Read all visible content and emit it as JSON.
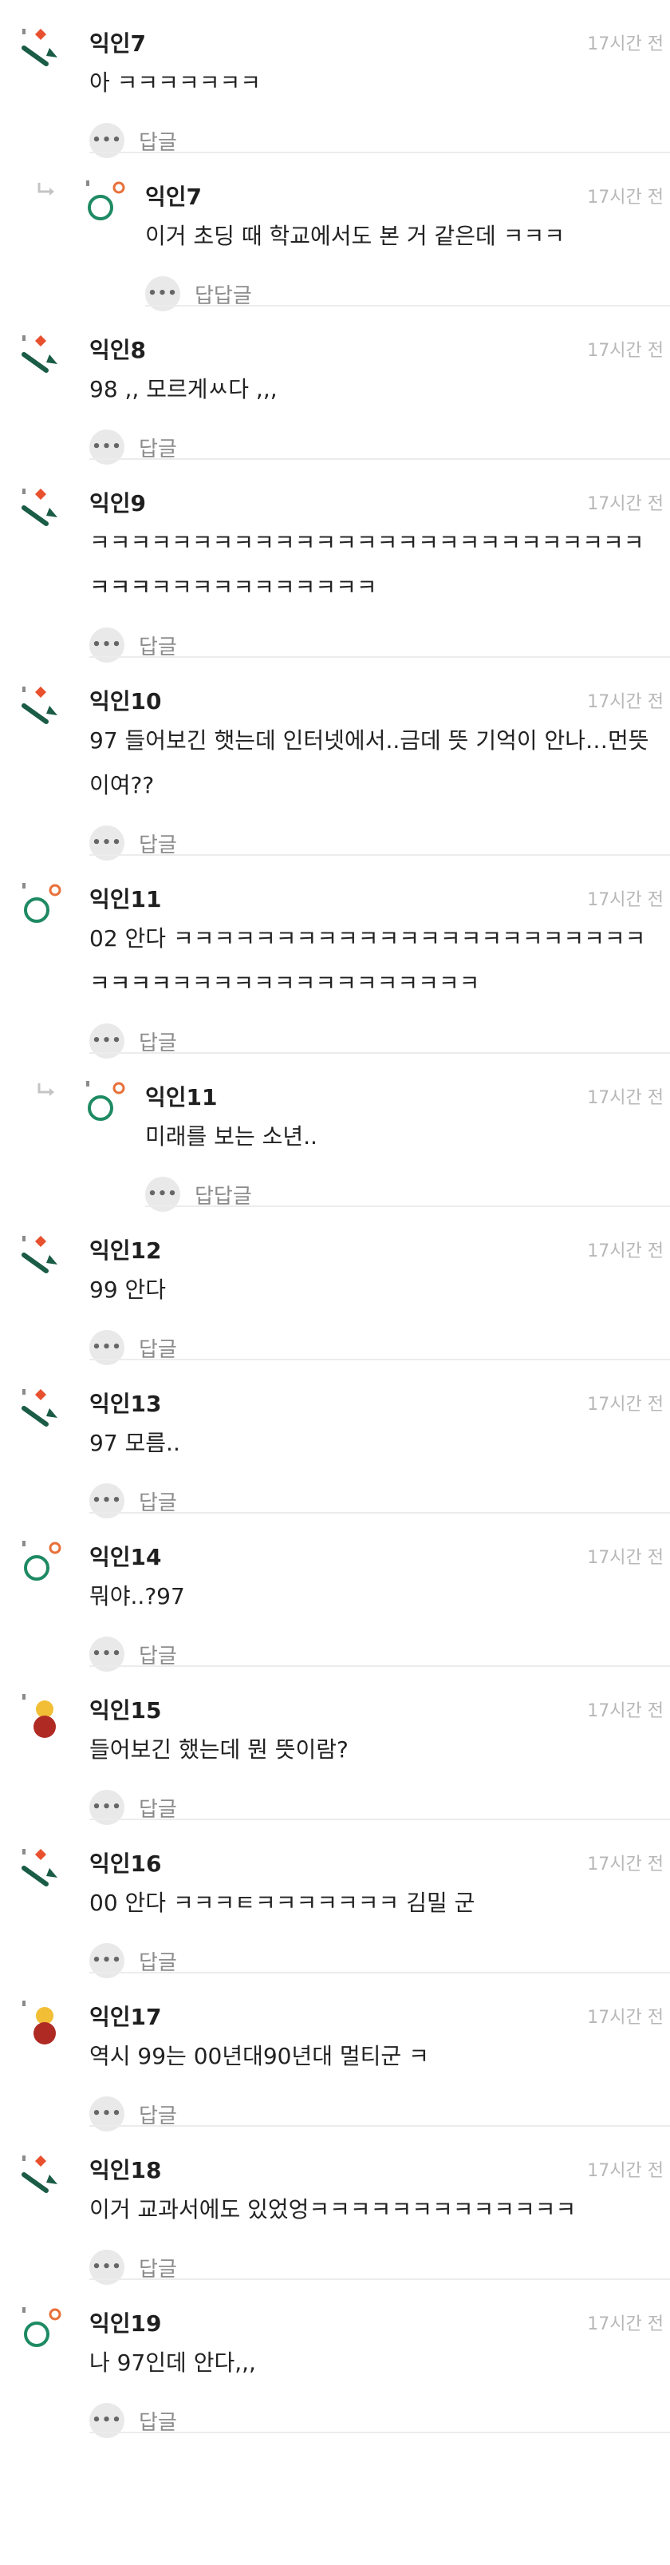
{
  "comments": [
    {
      "kind": "top",
      "avatar": "green-flag",
      "name": "익인7",
      "time": "17시간 전",
      "lines": [
        "아 ㅋㅋㅋㅋㅋㅋㅋ"
      ],
      "reply": "답글"
    },
    {
      "kind": "sub",
      "avatar": "ring",
      "name": "익인7",
      "time": "17시간 전",
      "lines": [
        "이거 초딩 때 학교에서도 본 거 같은데 ㅋㅋㅋ"
      ],
      "reply": "답답글"
    },
    {
      "kind": "top",
      "avatar": "green-flag",
      "name": "익인8",
      "time": "17시간 전",
      "lines": [
        "98 ,, 모르게ㅆ다 ,,,"
      ],
      "reply": "답글"
    },
    {
      "kind": "top",
      "avatar": "green-flag",
      "name": "익인9",
      "time": "17시간 전",
      "lines": [
        "ㅋㅋㅋㅋㅋㅋㅋㅋㅋㅋㅋㅋㅋㅋㅋㅋㅋㅋㅋㅋㅋㅋㅋㅋㅋㅋㅋㅋㅋㅋ",
        "ㅋㅋㅋㅋㅋㅋㅋㅋㅋㅋㅋㅋㅋㅋ"
      ],
      "reply": "답글"
    },
    {
      "kind": "top",
      "avatar": "green-flag",
      "name": "익인10",
      "time": "17시간 전",
      "lines": [
        "97 들어보긴 햇는데 인터넷에서..금데 뜻 기억이 안나…먼뜻",
        "이여??"
      ],
      "reply": "답글"
    },
    {
      "kind": "top",
      "avatar": "ring",
      "name": "익인11",
      "time": "17시간 전",
      "lines": [
        "02 안다 ㅋㅋㅋㅋㅋㅋㅋㅋㅋㅋㅋㅋㅋㅋㅋㅋㅋㅋㅋㅋㅋㅋㅋㅋㅋㅋㅋ",
        "ㅋㅋㅋㅋㅋㅋㅋㅋㅋㅋㅋㅋㅋㅋㅋㅋㅋㅋㅋ"
      ],
      "reply": "답글"
    },
    {
      "kind": "sub",
      "avatar": "ring",
      "name": "익인11",
      "time": "17시간 전",
      "lines": [
        "미래를 보는 소년.."
      ],
      "reply": "답답글"
    },
    {
      "kind": "top",
      "avatar": "green-flag",
      "name": "익인12",
      "time": "17시간 전",
      "lines": [
        "99 안다"
      ],
      "reply": "답글"
    },
    {
      "kind": "top",
      "avatar": "green-flag",
      "name": "익인13",
      "time": "17시간 전",
      "lines": [
        "97 모름.."
      ],
      "reply": "답글"
    },
    {
      "kind": "top",
      "avatar": "ring",
      "name": "익인14",
      "time": "17시간 전",
      "lines": [
        "뭐야..?97"
      ],
      "reply": "답글"
    },
    {
      "kind": "top",
      "avatar": "snowman",
      "name": "익인15",
      "time": "17시간 전",
      "lines": [
        "들어보긴 했는데 뭔 뜻이람?"
      ],
      "reply": "답글"
    },
    {
      "kind": "top",
      "avatar": "green-flag",
      "name": "익인16",
      "time": "17시간 전",
      "lines": [
        "00 안다 ㅋㅋㅋㅌㅋㅋㅋㅋㅋㅋㅋ 김밀 군"
      ],
      "reply": "답글"
    },
    {
      "kind": "top",
      "avatar": "snowman",
      "name": "익인17",
      "time": "17시간 전",
      "lines": [
        "역시 99는 00년대90년대 멀티군 ㅋ"
      ],
      "reply": "답글"
    },
    {
      "kind": "top",
      "avatar": "green-flag",
      "name": "익인18",
      "time": "17시간 전",
      "lines": [
        "이거 교과서에도 있었엉ㅋㅋㅋㅋㅋㅋㅋㅋㅋㅋㅋㅋㅋ"
      ],
      "reply": "답글"
    },
    {
      "kind": "top",
      "avatar": "ring",
      "name": "익인19",
      "time": "17시간 전",
      "lines": [
        "나 97인데 안다,,,"
      ],
      "reply": "답글"
    }
  ],
  "colors": {
    "green": "#1a5c45",
    "orange": "#e8502e",
    "ring": "#1e8a63",
    "ring_dot": "#e8703a",
    "yellow": "#f1be36",
    "red": "#b02a24"
  }
}
